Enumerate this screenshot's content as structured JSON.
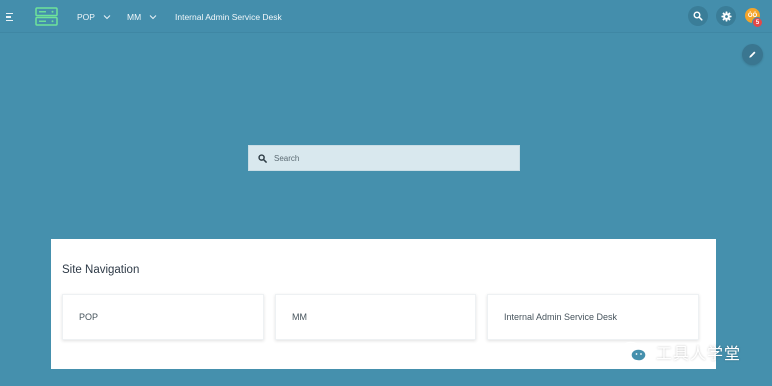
{
  "topbar": {
    "menu_icon": "hamburger-icon",
    "logo_icon": "server-rack-icon",
    "nav_items": [
      {
        "label": "POP",
        "has_dropdown": true
      },
      {
        "label": "MM",
        "has_dropdown": true
      },
      {
        "label": "Internal Admin Service Desk",
        "has_dropdown": false
      }
    ],
    "right_icons": [
      "search-icon",
      "gear-icon"
    ],
    "avatar_initials": "ÒÓ",
    "notification_count": "5"
  },
  "edit_button_icon": "pencil-icon",
  "search": {
    "placeholder": "Search",
    "value": ""
  },
  "site_navigation": {
    "title": "Site Navigation",
    "cards": [
      {
        "label": "POP"
      },
      {
        "label": "MM"
      },
      {
        "label": "Internal Admin Service Desk"
      }
    ]
  },
  "watermark": {
    "icon": "wechat-icon",
    "text": "工具人学堂"
  },
  "colors": {
    "background": "#4590ad",
    "topbar": "#448eac",
    "panel": "#ffffff",
    "search_field": "#d9e8ee",
    "avatar": "#f4a52a",
    "badge": "#e44848",
    "logo_accent": "#6ee39a"
  }
}
